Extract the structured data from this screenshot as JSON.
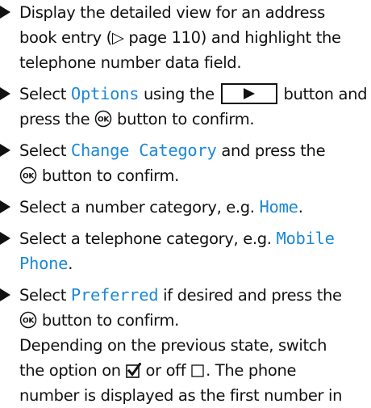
{
  "steps": [
    {
      "lines": [
        {
          "a": "Display the detailed view for an address"
        },
        {
          "a": "book entry (▷ page 110) and highlight the"
        },
        {
          "a": "telephone number data field."
        }
      ]
    },
    {
      "line1_before": "Select ",
      "line1_hl": "Options",
      "line1_mid": " using the ",
      "line1_after": " button and",
      "line2_before": "press the ",
      "line2_after": " button to confirm."
    },
    {
      "line1_before": "Select ",
      "line1_hl": "Change Category",
      "line1_after": " and press the",
      "line2_after": " button to confirm."
    },
    {
      "line1_before": "Select a number category, e.g. ",
      "line1_hl": "Home",
      "line1_after": "."
    },
    {
      "line1_before": "Select a telephone category, e.g. ",
      "line1_hl": "Mobile",
      "line2_hl": "Phone",
      "line2_after": "."
    },
    {
      "line1_before": "Select ",
      "line1_hl": "Preferred",
      "line1_after": " if desired and press the",
      "line2_after": " button to confirm.",
      "note1": "Depending on the previous state, switch",
      "note2_before": "the option on ",
      "note2_mid": " or off ",
      "note2_after": ". The phone",
      "note3": "number is displayed as the first number in"
    }
  ],
  "icons": {
    "bullet": "triangle-bullet-icon",
    "ok": "ok-button-icon",
    "play": "play-right-key-icon",
    "checked": "checkbox-checked-icon",
    "unchecked": "checkbox-empty-icon"
  },
  "ok_label": "OK",
  "colors": {
    "highlight": "#1e88d6",
    "text": "#111111"
  }
}
